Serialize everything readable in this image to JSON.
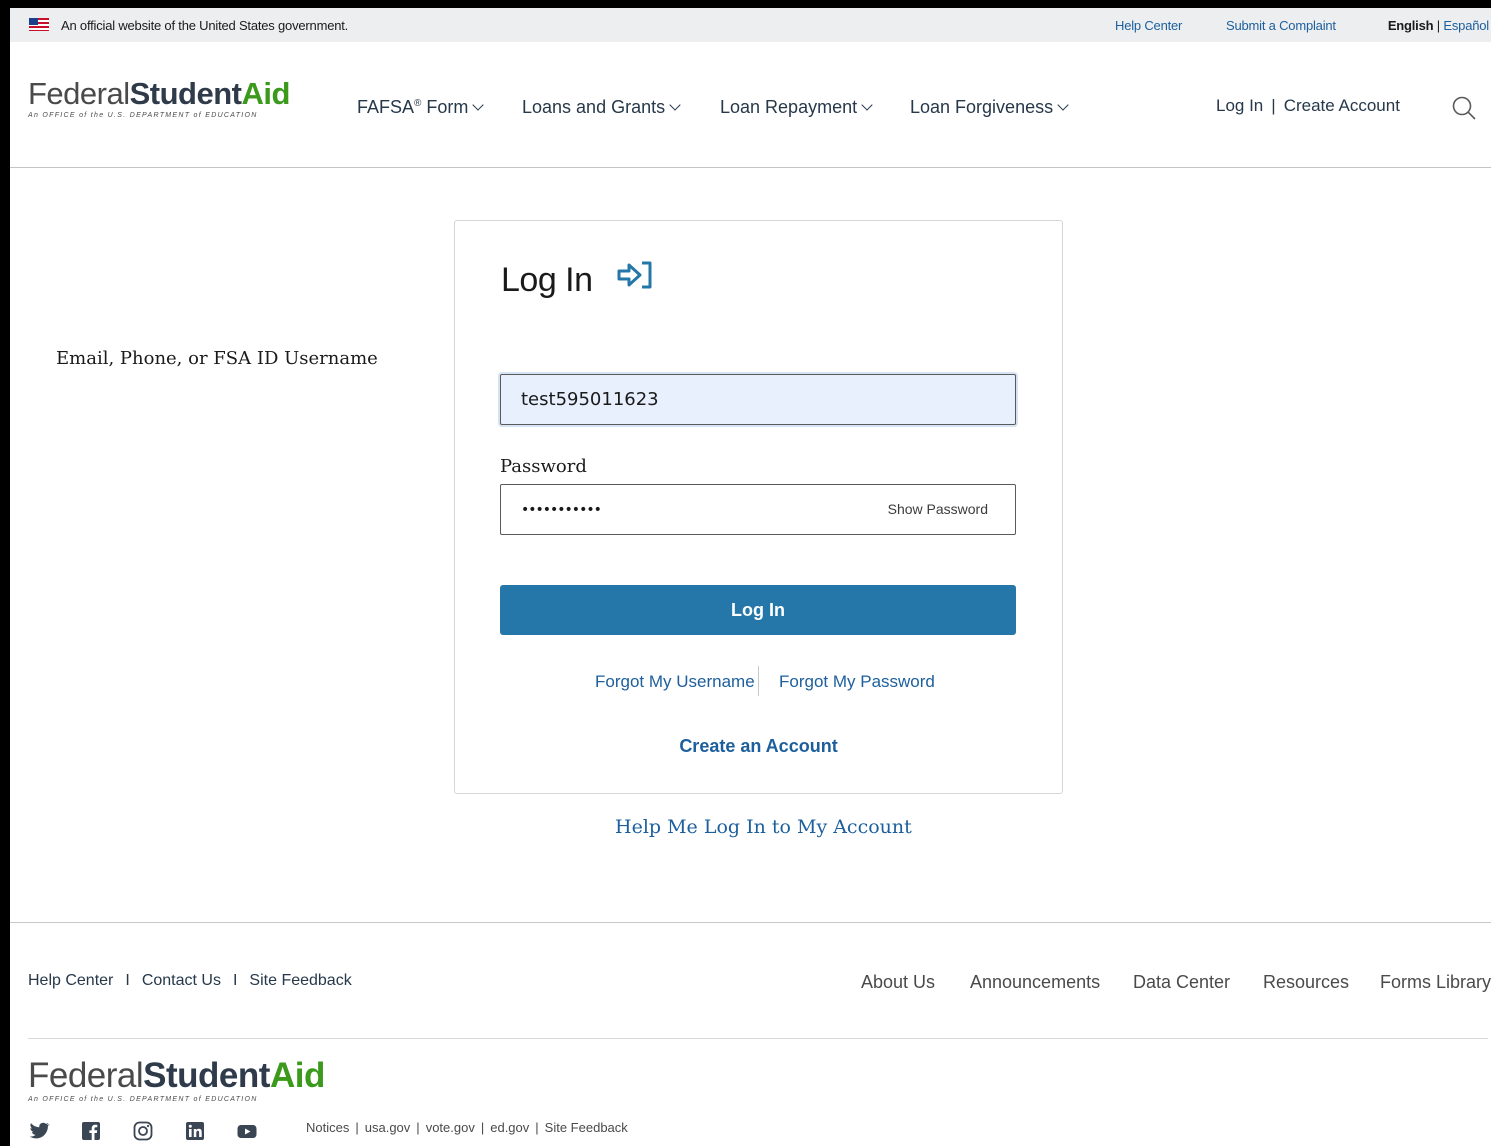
{
  "gov_banner": {
    "official_text": "An official website of the United States government.",
    "help_center": "Help Center",
    "submit_complaint": "Submit a Complaint",
    "lang_en": "English",
    "lang_sep": "|",
    "lang_es": "Español"
  },
  "header": {
    "logo_federal": "Federal",
    "logo_student": "Student",
    "logo_aid": "Aid",
    "logo_tagline": "An OFFICE of the U.S. DEPARTMENT of EDUCATION",
    "nav": [
      {
        "label": "FAFSA",
        "sup": "®",
        "suffix": " Form"
      },
      {
        "label": "Loans and Grants"
      },
      {
        "label": "Loan Repayment"
      },
      {
        "label": "Loan Forgiveness"
      }
    ],
    "login_link": "Log In",
    "create_account_link": "Create Account",
    "acct_sep": "|"
  },
  "login_card": {
    "title": "Log In",
    "username_label": "Email, Phone, or FSA ID Username",
    "username_value": "test595011623",
    "password_label": "Password",
    "password_value": "•••••••••••",
    "show_password": "Show Password",
    "submit_label": "Log In",
    "forgot_username": "Forgot My Username",
    "forgot_password": "Forgot My Password",
    "create_account": "Create an Account"
  },
  "help_link": "Help Me Log In to My Account",
  "footer": {
    "left_links": [
      "Help Center",
      "Contact Us",
      "Site Feedback"
    ],
    "left_sep": "I",
    "right_links": [
      "About Us",
      "Announcements",
      "Data Center",
      "Resources",
      "Forms Library"
    ],
    "logo_tagline": "An OFFICE of the U.S. DEPARTMENT of EDUCATION",
    "social_icons": [
      "twitter-icon",
      "facebook-icon",
      "instagram-icon",
      "linkedin-icon",
      "youtube-icon"
    ],
    "notices": [
      "Notices",
      "usa.gov",
      "vote.gov",
      "ed.gov",
      "Site Feedback"
    ],
    "notices_sep": "|"
  },
  "colors": {
    "link": "#1d5f9c",
    "button": "#2477a8",
    "brand_green": "#3b9a1c",
    "input_autofill": "#e8f0fe"
  }
}
